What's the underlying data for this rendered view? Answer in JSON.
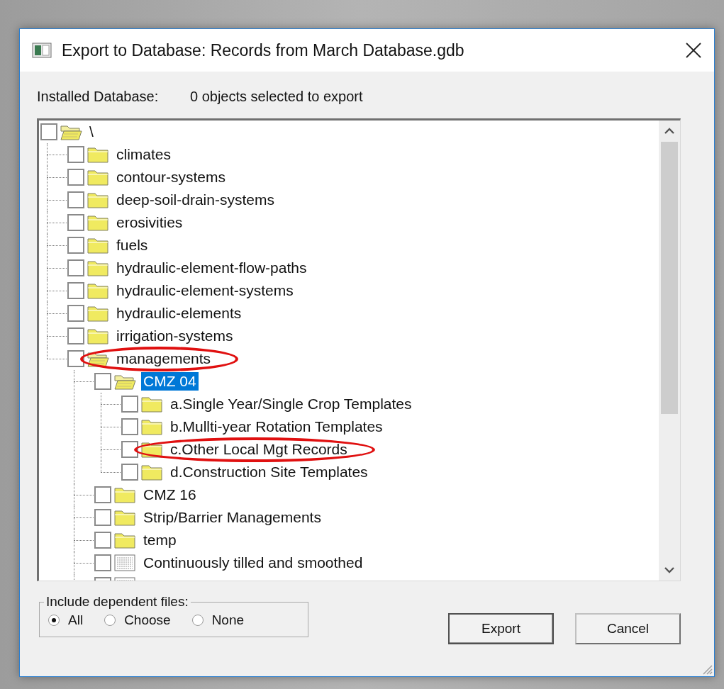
{
  "window": {
    "title": "Export to Database: Records from March Database.gdb"
  },
  "header": {
    "label": "Installed Database:",
    "status": "0 objects selected to export"
  },
  "tree": [
    {
      "label": "\\",
      "kind": "folder",
      "checked": false,
      "selected": false,
      "expanded": true,
      "circled": false,
      "children": [
        {
          "label": "climates",
          "kind": "folder",
          "checked": false,
          "selected": false,
          "expanded": false,
          "circled": false
        },
        {
          "label": "contour-systems",
          "kind": "folder",
          "checked": false,
          "selected": false,
          "expanded": false,
          "circled": false
        },
        {
          "label": "deep-soil-drain-systems",
          "kind": "folder",
          "checked": false,
          "selected": false,
          "expanded": false,
          "circled": false
        },
        {
          "label": "erosivities",
          "kind": "folder",
          "checked": false,
          "selected": false,
          "expanded": false,
          "circled": false
        },
        {
          "label": "fuels",
          "kind": "folder",
          "checked": false,
          "selected": false,
          "expanded": false,
          "circled": false
        },
        {
          "label": "hydraulic-element-flow-paths",
          "kind": "folder",
          "checked": false,
          "selected": false,
          "expanded": false,
          "circled": false
        },
        {
          "label": "hydraulic-element-systems",
          "kind": "folder",
          "checked": false,
          "selected": false,
          "expanded": false,
          "circled": false
        },
        {
          "label": "hydraulic-elements",
          "kind": "folder",
          "checked": false,
          "selected": false,
          "expanded": false,
          "circled": false
        },
        {
          "label": "irrigation-systems",
          "kind": "folder",
          "checked": false,
          "selected": false,
          "expanded": false,
          "circled": false
        },
        {
          "label": "managements",
          "kind": "folder",
          "checked": false,
          "selected": false,
          "expanded": true,
          "circled": true,
          "children": [
            {
              "label": "CMZ 04",
              "kind": "folder",
              "checked": false,
              "selected": true,
              "expanded": true,
              "circled": false,
              "children": [
                {
                  "label": "a.Single Year/Single Crop Templates",
                  "kind": "folder",
                  "checked": false,
                  "selected": false,
                  "expanded": false,
                  "circled": false
                },
                {
                  "label": "b.Mullti-year Rotation Templates",
                  "kind": "folder",
                  "checked": false,
                  "selected": false,
                  "expanded": false,
                  "circled": false
                },
                {
                  "label": "c.Other Local Mgt Records",
                  "kind": "folder",
                  "checked": false,
                  "selected": false,
                  "expanded": false,
                  "circled": true
                },
                {
                  "label": "d.Construction Site Templates",
                  "kind": "folder",
                  "checked": false,
                  "selected": false,
                  "expanded": false,
                  "circled": false
                }
              ]
            },
            {
              "label": "CMZ 16",
              "kind": "folder",
              "checked": false,
              "selected": false,
              "expanded": false,
              "circled": false
            },
            {
              "label": "Strip/Barrier Managements",
              "kind": "folder",
              "checked": false,
              "selected": false,
              "expanded": false,
              "circled": false
            },
            {
              "label": "temp",
              "kind": "folder",
              "checked": false,
              "selected": false,
              "expanded": false,
              "circled": false
            },
            {
              "label": "Continuously tilled and smoothed",
              "kind": "record",
              "checked": false,
              "selected": false,
              "circled": false
            },
            {
              "kind": "record",
              "selected": false,
              "circled": false
            }
          ]
        }
      ]
    }
  ],
  "dependent_files": {
    "legend": "Include dependent files:",
    "options": [
      {
        "label": "All",
        "selected": true
      },
      {
        "label": "Choose",
        "selected": false
      },
      {
        "label": "None",
        "selected": false
      }
    ]
  },
  "buttons": [
    {
      "label": "Export",
      "default": true
    },
    {
      "label": "Cancel",
      "default": false
    }
  ]
}
